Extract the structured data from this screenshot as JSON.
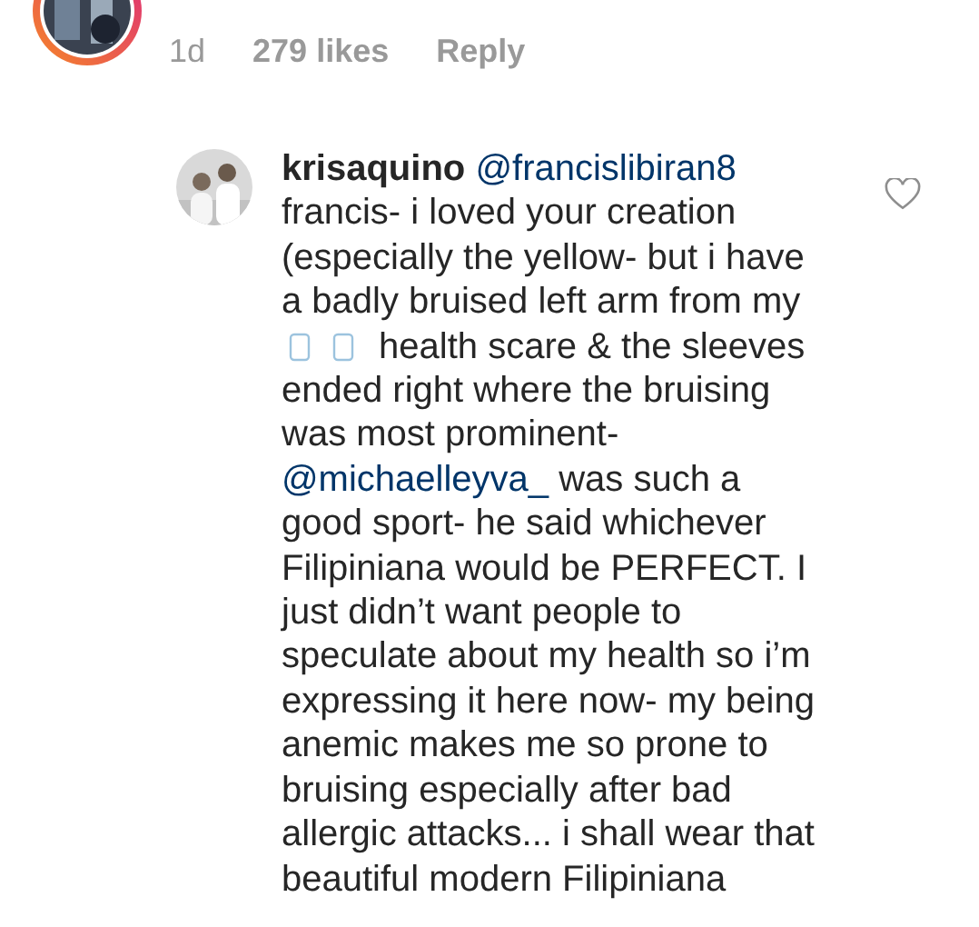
{
  "parent_comment": {
    "time": "1d",
    "likes": "279 likes",
    "reply": "Reply"
  },
  "reply_comment": {
    "username": "krisaquino",
    "liked": false,
    "lines": [
      [
        {
          "kind": "mention",
          "text": "@francislibiran8"
        }
      ],
      [
        {
          "kind": "text",
          "text": "francis- i loved your creation"
        }
      ],
      [
        {
          "kind": "text",
          "text": "(especially the yellow- but i have"
        }
      ],
      [
        {
          "kind": "text",
          "text": "a badly bruised left arm from my"
        }
      ],
      [
        {
          "kind": "glyph"
        },
        {
          "kind": "glyph"
        },
        {
          "kind": "text",
          "text": " health scare & the sleeves"
        }
      ],
      [
        {
          "kind": "text",
          "text": "ended right where the bruising"
        }
      ],
      [
        {
          "kind": "text",
          "text": "was most prominent-"
        }
      ],
      [
        {
          "kind": "mention",
          "text": "@michaelleyva_"
        },
        {
          "kind": "text",
          "text": " was such a"
        }
      ],
      [
        {
          "kind": "text",
          "text": "good sport- he said whichever"
        }
      ],
      [
        {
          "kind": "text",
          "text": "Filipiniana would be PERFECT. I"
        }
      ],
      [
        {
          "kind": "text",
          "text": "just didn’t want people to"
        }
      ],
      [
        {
          "kind": "text",
          "text": "speculate about my health so i’m"
        }
      ],
      [
        {
          "kind": "text",
          "text": "expressing it here now- my being"
        }
      ],
      [
        {
          "kind": "text",
          "text": "anemic makes me so prone to"
        }
      ],
      [
        {
          "kind": "text",
          "text": "bruising especially after bad"
        }
      ],
      [
        {
          "kind": "text",
          "text": "allergic attacks... i shall wear that"
        }
      ],
      [
        {
          "kind": "text",
          "text": "beautiful modern Filipiniana"
        }
      ]
    ]
  }
}
